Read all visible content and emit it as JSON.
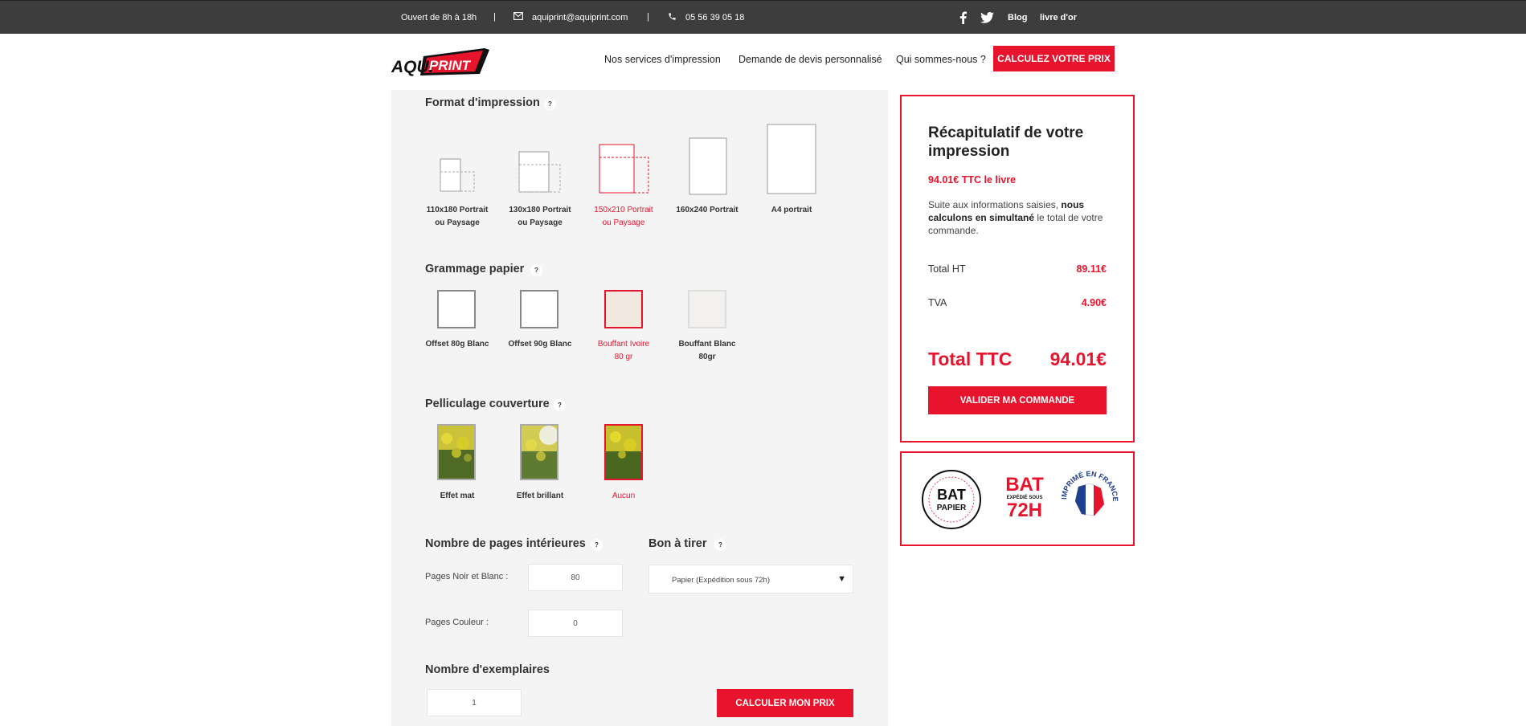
{
  "topbar": {
    "hours": "Ouvert de 8h à 18h",
    "email": "aquiprint@aquiprint.com",
    "phone": "05 56 39 05 18",
    "blog": "Blog",
    "guestbook": "livre d'or"
  },
  "header": {
    "logo_text_1": "AQUI",
    "logo_text_2": "PRINT",
    "nav": [
      "Nos services d'impression",
      "Demande de devis personnalisé",
      "Qui sommes-nous ?"
    ],
    "cta": "CALCULEZ VOTRE PRIX"
  },
  "config": {
    "format": {
      "title": "Format d'impression",
      "help": "?",
      "options": [
        {
          "line1": "110x180 Portrait",
          "line2": "ou Paysage",
          "selected": false
        },
        {
          "line1": "130x180 Portrait",
          "line2": "ou Paysage",
          "selected": false
        },
        {
          "line1": "150x210 Portrait",
          "line2": "ou Paysage",
          "selected": true
        },
        {
          "line1": "160x240 Portrait",
          "line2": "",
          "selected": false
        },
        {
          "line1": "A4 portrait",
          "line2": "",
          "selected": false
        }
      ]
    },
    "paper": {
      "title": "Grammage papier",
      "help": "?",
      "options": [
        {
          "line1": "Offset 80g Blanc",
          "line2": "",
          "selected": false
        },
        {
          "line1": "Offset 90g Blanc",
          "line2": "",
          "selected": false
        },
        {
          "line1": "Bouffant Ivoire",
          "line2": "80 gr",
          "selected": true
        },
        {
          "line1": "Bouffant Blanc",
          "line2": "80gr",
          "selected": false
        }
      ]
    },
    "lamination": {
      "title": "Pelliculage couverture",
      "help": "?",
      "options": [
        {
          "label": "Effet mat",
          "selected": false
        },
        {
          "label": "Effet brillant",
          "selected": false
        },
        {
          "label": "Aucun",
          "selected": true
        }
      ]
    },
    "pages": {
      "title": "Nombre de pages intérieures",
      "help": "?",
      "bw_label": "Pages Noir et Blanc :",
      "bw_value": "80",
      "color_label": "Pages Couleur :",
      "color_value": "0"
    },
    "proof": {
      "title": "Bon à tirer",
      "help": "?",
      "selected": "Papier (Expédition sous 72h)"
    },
    "copies": {
      "title": "Nombre d'exemplaires",
      "value": "1"
    },
    "calc_button": "CALCULER MON PRIX"
  },
  "summary": {
    "title": "Récapitulatif de votre impression",
    "unit_price": "94.01€ TTC le livre",
    "desc_1": "Suite aux informations saisies, ",
    "desc_bold": "nous calculons en simultané",
    "desc_2": " le total de votre commande.",
    "ht_label": "Total HT",
    "ht_value": "89.11€",
    "tva_label": "TVA",
    "tva_value": "4.90€",
    "ttc_label": "Total TTC",
    "ttc_value": "94.01€",
    "validate": "VALIDER MA COMMANDE"
  },
  "badges": {
    "bat_paper_big": "BAT",
    "bat_paper_small": "PAPIER",
    "bat_72_big": "BAT",
    "bat_72_sub": "EXPÉDIÉ SOUS",
    "bat_72_time": "72H",
    "france_text": "IMPRIMÉ EN FRANCE"
  },
  "colors": {
    "accent": "#e8132d",
    "topbar": "#3d3d3d",
    "panel": "#f4f4f4"
  }
}
